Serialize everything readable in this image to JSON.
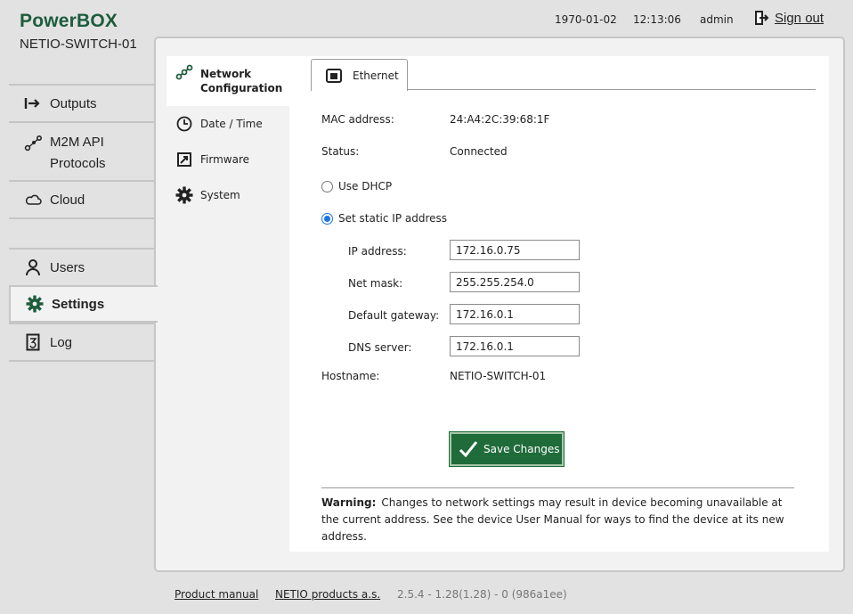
{
  "brand": {
    "title": "PowerBOX",
    "device": "NETIO-SWITCH-01"
  },
  "topbar": {
    "date": "1970-01-02",
    "time": "12:13:06",
    "user": "admin",
    "sign_out": "Sign out"
  },
  "nav": {
    "outputs": "Outputs",
    "m2m_line1": "M2M API",
    "m2m_line2": "Protocols",
    "cloud": "Cloud",
    "users": "Users",
    "settings": "Settings",
    "log": "Log"
  },
  "subnav": {
    "network_line1": "Network",
    "network_line2": "Configuration",
    "datetime": "Date / Time",
    "firmware": "Firmware",
    "system": "System"
  },
  "tabs": {
    "ethernet": "Ethernet"
  },
  "form": {
    "mac_label": "MAC address:",
    "mac_value": "24:A4:2C:39:68:1F",
    "status_label": "Status:",
    "status_value": "Connected",
    "dhcp_label": "Use DHCP",
    "dhcp_checked": false,
    "static_label": "Set static IP address",
    "static_checked": true,
    "ip_label": "IP address:",
    "ip_value": "172.16.0.75",
    "mask_label": "Net mask:",
    "mask_value": "255.255.254.0",
    "gateway_label": "Default gateway:",
    "gateway_value": "172.16.0.1",
    "dns_label": "DNS server:",
    "dns_value": "172.16.0.1",
    "hostname_label": "Hostname:",
    "hostname_value": "NETIO-SWITCH-01",
    "save_label": "Save Changes"
  },
  "warning": {
    "title": "Warning:",
    "text": "Changes to network settings may result in device becoming unavailable at the current address. See the device User Manual for ways to find the device at its new address."
  },
  "footer": {
    "manual": "Product manual",
    "company": "NETIO products a.s.",
    "version": "2.5.4 - 1.28(1.28) - 0 (986a1ee)"
  },
  "colors": {
    "brand_green": "#1d5c3c",
    "button_green": "#1f6b3a",
    "radio_blue": "#1a73e8"
  },
  "icons": {
    "sign_out": "sign-out-icon",
    "outputs": "outputs-arrow-icon",
    "m2m": "network-nodes-icon",
    "cloud": "cloud-icon",
    "users": "user-icon",
    "settings": "gear-icon",
    "log": "log-icon",
    "network": "network-nodes-icon",
    "datetime": "clock-icon",
    "firmware": "firmware-icon",
    "system": "gear-icon",
    "ethernet": "ethernet-port-icon",
    "save": "checkmark-icon"
  }
}
